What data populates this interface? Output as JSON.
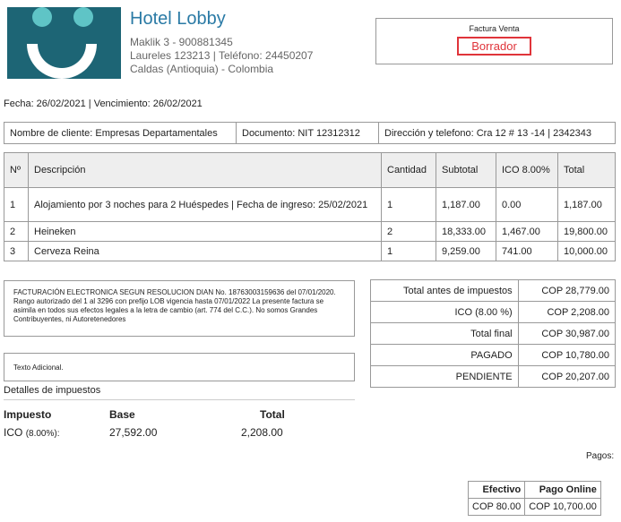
{
  "hotel": {
    "name": "Hotel Lobby",
    "address1": "Maklik 3 - 900881345",
    "address2": "Laureles 123213 | Teléfono: 24450207",
    "address3": "Caldas (Antioquia) - Colombia"
  },
  "invoice": {
    "type_label": "Factura Venta",
    "status": "Borrador",
    "dates": "Fecha: 26/02/2021 | Vencimiento: 26/02/2021"
  },
  "client": {
    "name": "Nombre de cliente: Empresas Departamentales",
    "document": "Documento: NIT 12312312",
    "address": "Dirección y telefono: Cra 12 # 13 -14 | 2342343"
  },
  "items_table": {
    "headers": [
      "Nº",
      "Descripción",
      "Cantidad",
      "Subtotal",
      "ICO 8.00%",
      "Total"
    ],
    "rows": [
      [
        "1",
        "Alojamiento por 3 noches para 2 Huéspedes | Fecha de ingreso: 25/02/2021",
        "1",
        "1,187.00",
        "0.00",
        "1,187.00"
      ],
      [
        "2",
        "Heineken",
        "2",
        "18,333.00",
        "1,467.00",
        "19,800.00"
      ],
      [
        "3",
        "Cerveza Reina",
        "1",
        "9,259.00",
        "741.00",
        "10,000.00"
      ]
    ]
  },
  "legal_text": "FACTURACIÓN ELECTRONICA SEGUN RESOLUCION DIAN No. 18763003159636 del 07/01/2020. Rango autorizado del 1 al 3296 con prefijo LOB vigencia hasta 07/01/2022 La presente factura se asimila en todos sus efectos legales a la letra de cambio (art. 774 del C.C.). No somos Grandes Contribuyentes, ni Autoretenedores",
  "additional_text": "Texto Adicional.",
  "totals": [
    {
      "label": "Total antes de impuestos",
      "value": "COP 28,779.00"
    },
    {
      "label": "ICO (8.00 %)",
      "value": "COP 2,208.00"
    },
    {
      "label": "Total final",
      "value": "COP 30,987.00"
    },
    {
      "label": "PAGADO",
      "value": "COP 10,780.00"
    },
    {
      "label": "PENDIENTE",
      "value": "COP 20,207.00"
    }
  ],
  "tax_details": {
    "title": "Detalles de impuestos",
    "headers": [
      "Impuesto",
      "Base",
      "Total"
    ],
    "row": {
      "name": "ICO",
      "rate": "(8.00%):",
      "base": "27,592.00",
      "total": "2,208.00"
    }
  },
  "payments": {
    "label": "Pagos:",
    "headers": [
      "Efectivo",
      "Pago Online"
    ],
    "values": [
      "COP 80.00",
      "COP 10,700.00"
    ]
  }
}
